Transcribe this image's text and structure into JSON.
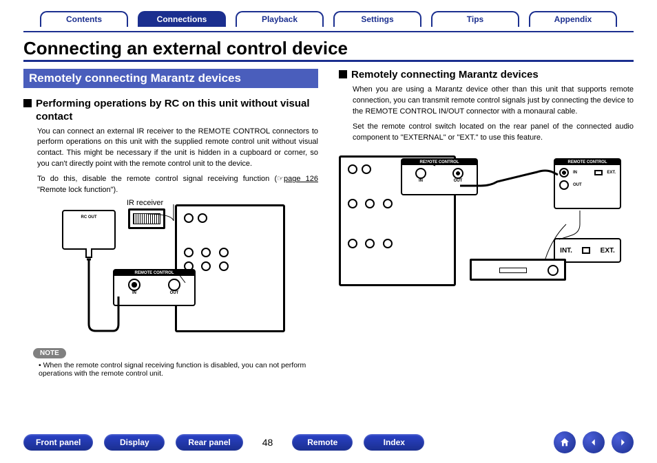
{
  "tabs": {
    "contents": "Contents",
    "connections": "Connections",
    "playback": "Playback",
    "settings": "Settings",
    "tips": "Tips",
    "appendix": "Appendix"
  },
  "page_title": "Connecting an external control device",
  "left": {
    "banner": "Remotely connecting Marantz devices",
    "heading": "Performing operations by RC on this unit without visual contact",
    "para1": "You can connect an external IR receiver to the REMOTE CONTROL connectors to perform operations on this unit with the supplied remote control unit without visual contact. This might be necessary if the unit is hidden in a cupboard or corner, so you can't directly point with the remote control unit to the device.",
    "para2a": "To do this, disable the remote control signal receiving function (",
    "para2_link": "page 126",
    "para2b": " \"Remote lock function\").",
    "ir_label": "IR receiver",
    "note_label": "NOTE",
    "note_item": "When the remote control signal receiving function is disabled, you can not perform operations with the remote control unit.",
    "diagram": {
      "rc_out": "RC OUT",
      "remote_control": "REMOTE CONTROL",
      "in": "IN",
      "out": "OUT"
    }
  },
  "right": {
    "heading": "Remotely connecting Marantz devices",
    "para1": "When you are using a Marantz device other than this unit that supports remote connection, you can transmit remote control signals just by connecting the device to the REMOTE CONTROL IN/OUT connector with a monaural cable.",
    "para2": "Set the remote control switch located on the rear panel of the connected audio component to \"EXTERNAL\" or \"EXT.\" to use this feature.",
    "diagram": {
      "remote_control": "REMOTE CONTROL",
      "in": "IN",
      "out": "OUT",
      "int": "INT.",
      "ext": "EXT."
    }
  },
  "footer": {
    "front_panel": "Front panel",
    "display": "Display",
    "rear_panel": "Rear panel",
    "remote": "Remote",
    "index": "Index",
    "page": "48"
  }
}
